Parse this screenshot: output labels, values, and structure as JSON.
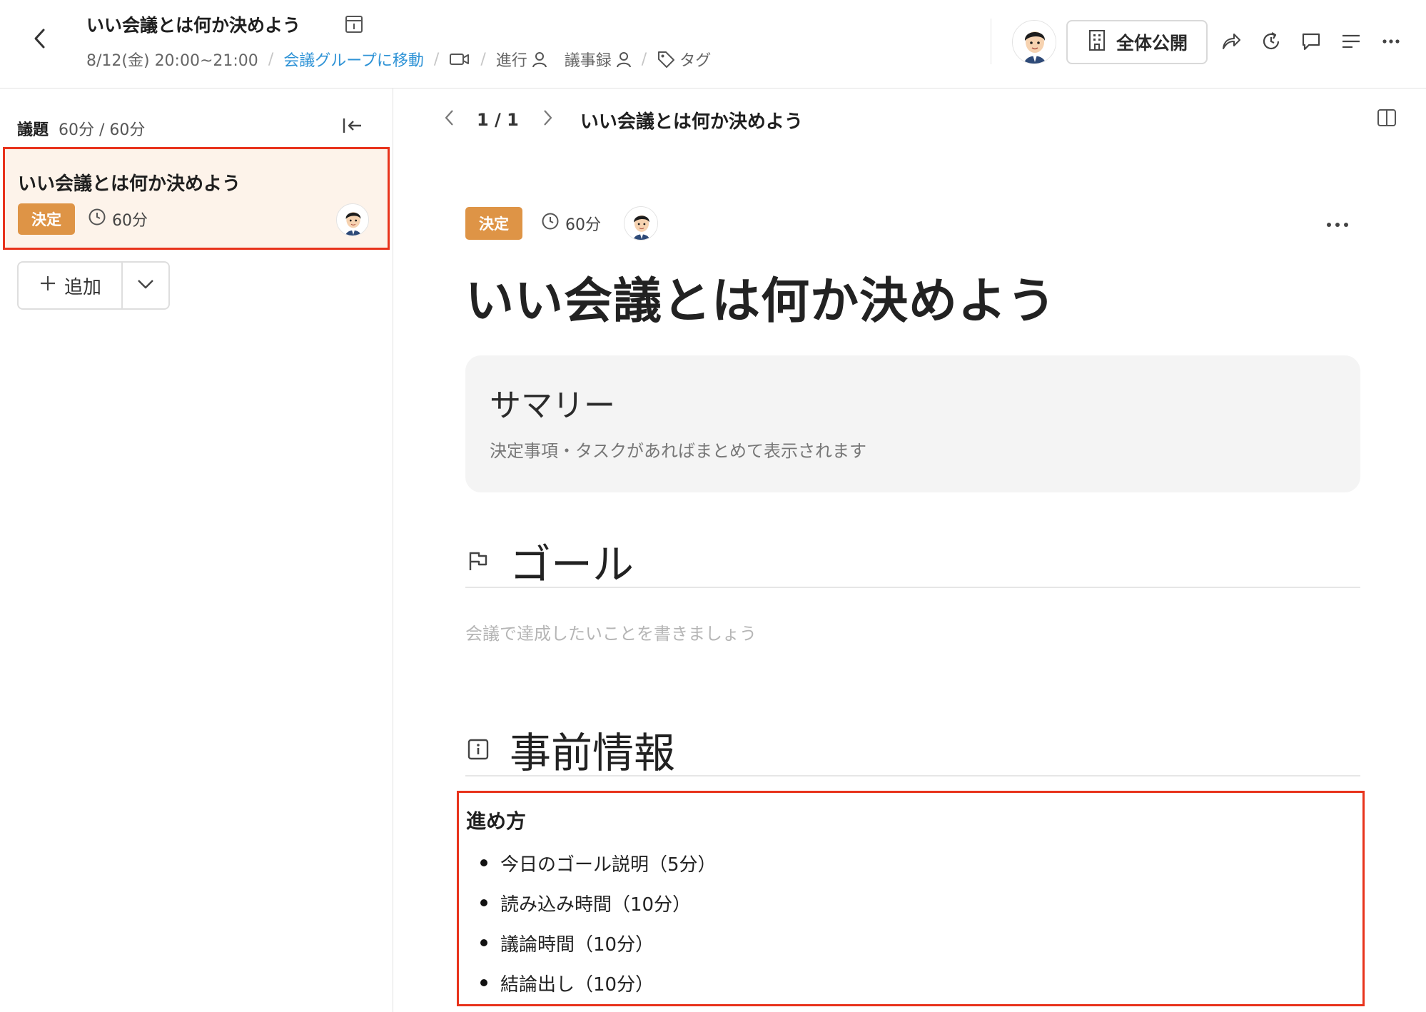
{
  "topbar": {
    "title": "いい会議とは何か決めよう",
    "datetime": "8/12(金) 20:00~21:00",
    "group_link": "会議グループに移動",
    "facilitator_label": "進行",
    "minutes_label": "議事録",
    "tag_label": "タグ",
    "share_label": "全体公開",
    "icons": [
      "back-icon",
      "template-icon",
      "video-icon",
      "person-icon",
      "tag-icon",
      "building-icon",
      "share-icon",
      "history-icon",
      "comment-icon",
      "outline-icon",
      "more-icon"
    ]
  },
  "sidebar": {
    "label": "議題",
    "time_total": "60分 / 60分",
    "items": [
      {
        "title": "いい会議とは何か決めよう",
        "badge": "決定",
        "duration": "60分"
      }
    ],
    "add_label": "追加"
  },
  "main": {
    "pager": {
      "indicator": "1 / 1",
      "title": "いい会議とは何か決めよう"
    },
    "badge": "決定",
    "duration": "60分",
    "title": "いい会議とは何か決めよう",
    "summary": {
      "title": "サマリー",
      "description": "決定事項・タスクがあればまとめて表示されます"
    },
    "goal": {
      "title": "ゴール",
      "placeholder": "会議で達成したいことを書きましょう"
    },
    "pre_info": {
      "title": "事前情報",
      "steps_heading": "進め方",
      "steps": [
        "今日のゴール説明（5分）",
        "読み込み時間（10分）",
        "議論時間（10分）",
        "結論出し（10分）"
      ]
    }
  },
  "colors": {
    "badge": "#de9446",
    "highlight_border": "#e8331c",
    "link": "#2f93d6",
    "selected_item_bg": "#fdf3ea"
  }
}
